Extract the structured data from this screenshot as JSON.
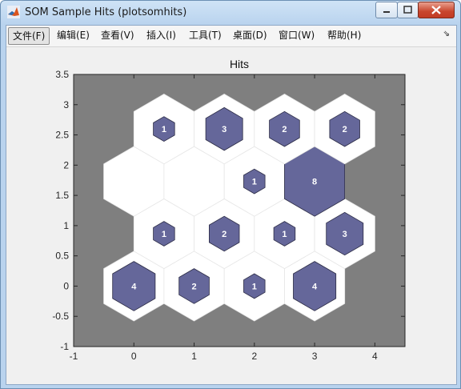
{
  "window": {
    "title": "SOM Sample Hits (plotsomhits)"
  },
  "menu": {
    "items": [
      {
        "label": "文件(F)",
        "name": "menu-file"
      },
      {
        "label": "编辑(E)",
        "name": "menu-edit"
      },
      {
        "label": "查看(V)",
        "name": "menu-view"
      },
      {
        "label": "插入(I)",
        "name": "menu-insert"
      },
      {
        "label": "工具(T)",
        "name": "menu-tools"
      },
      {
        "label": "桌面(D)",
        "name": "menu-desktop"
      },
      {
        "label": "窗口(W)",
        "name": "menu-window"
      },
      {
        "label": "帮助(H)",
        "name": "menu-help"
      }
    ]
  },
  "chart_data": {
    "type": "hexagonal-hit-map",
    "title": "Hits",
    "xlim": [
      -1,
      4.5
    ],
    "ylim": [
      -1,
      3.5
    ],
    "xticks": [
      -1,
      0,
      1,
      2,
      3,
      4
    ],
    "yticks": [
      -1,
      -0.5,
      0,
      0.5,
      1,
      1.5,
      2,
      2.5,
      3,
      3.5
    ],
    "max_hits": 8,
    "colors": {
      "axes_bg": "#7f7f7f",
      "cell": "#ffffff",
      "hit_fill": "#65679a",
      "hit_stroke": "#2b2b44",
      "hit_text": "#ffffff"
    },
    "neurons": [
      {
        "x": 0,
        "y": 0,
        "hits": 4
      },
      {
        "x": 1,
        "y": 0,
        "hits": 2
      },
      {
        "x": 2,
        "y": 0,
        "hits": 1
      },
      {
        "x": 3,
        "y": 0,
        "hits": 4
      },
      {
        "x": 0.5,
        "y": 0.866,
        "hits": 1
      },
      {
        "x": 1.5,
        "y": 0.866,
        "hits": 2
      },
      {
        "x": 2.5,
        "y": 0.866,
        "hits": 1
      },
      {
        "x": 3.5,
        "y": 0.866,
        "hits": 3
      },
      {
        "x": 0,
        "y": 1.732,
        "hits": 0
      },
      {
        "x": 1,
        "y": 1.732,
        "hits": 0
      },
      {
        "x": 2,
        "y": 1.732,
        "hits": 1
      },
      {
        "x": 3,
        "y": 1.732,
        "hits": 8
      },
      {
        "x": 0.5,
        "y": 2.598,
        "hits": 1
      },
      {
        "x": 1.5,
        "y": 2.598,
        "hits": 3
      },
      {
        "x": 2.5,
        "y": 2.598,
        "hits": 2
      },
      {
        "x": 3.5,
        "y": 2.598,
        "hits": 2
      }
    ]
  }
}
